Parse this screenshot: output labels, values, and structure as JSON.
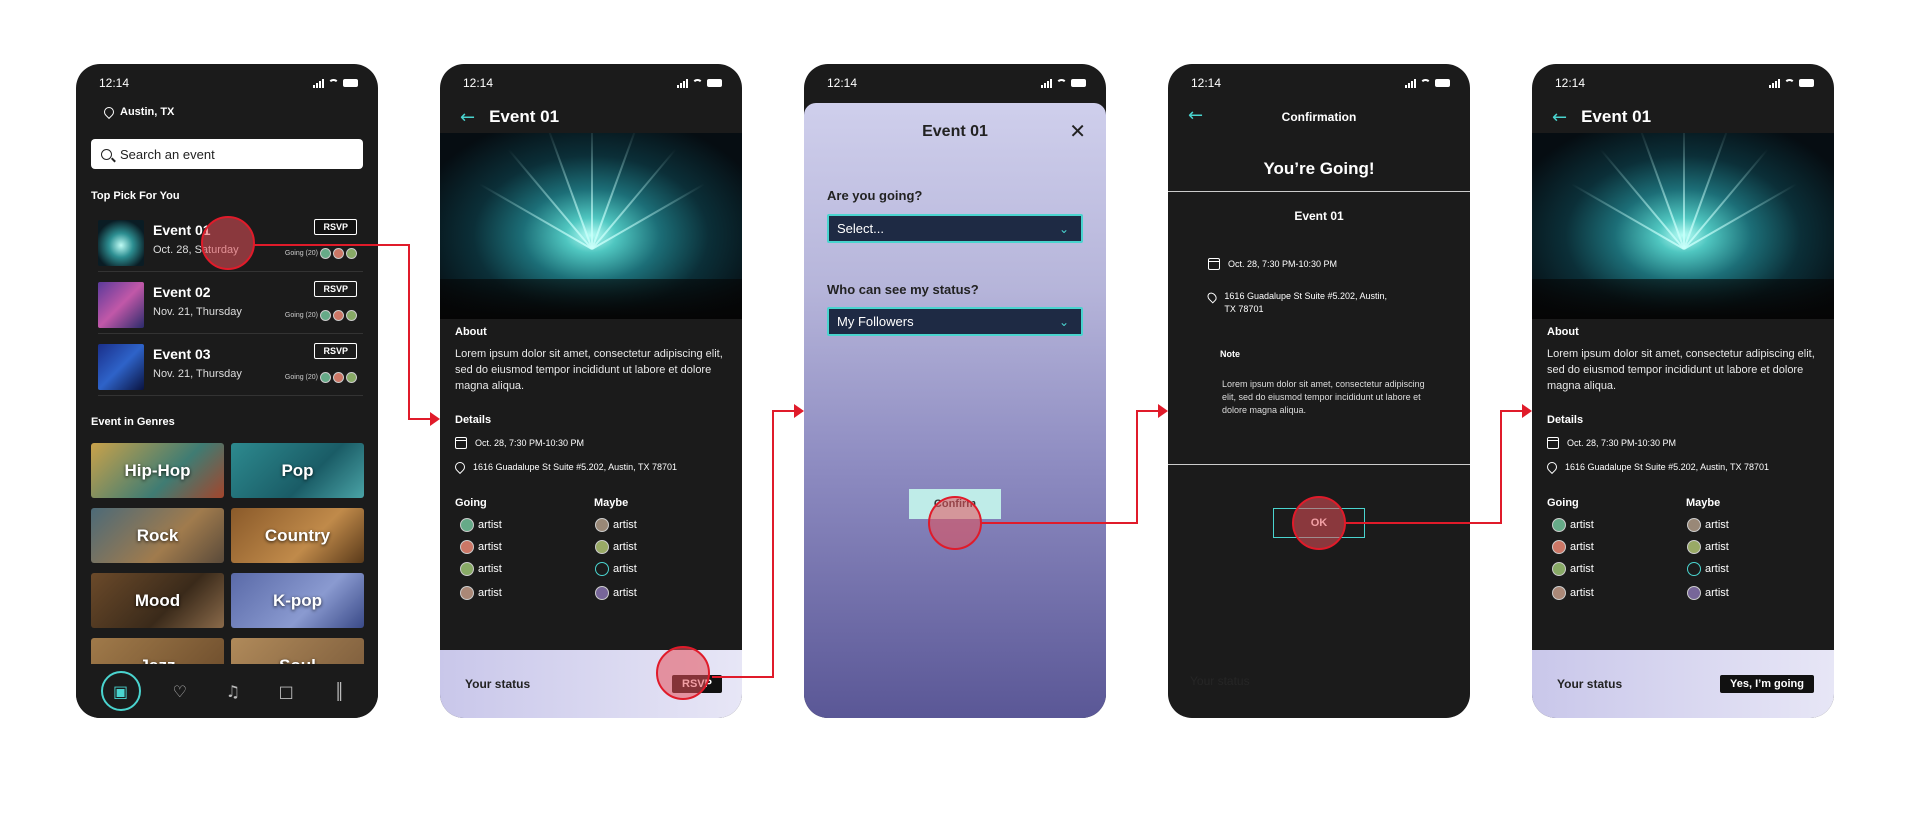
{
  "time": "12:14",
  "screen1": {
    "location": "Austin, TX",
    "search_placeholder": "Search an event",
    "top_pick_heading": "Top Pick For You",
    "events": [
      {
        "title": "Event 01",
        "date": "Oct. 28, Saturday",
        "rsvp": "RSVP",
        "going": "Going (20)"
      },
      {
        "title": "Event 02",
        "date": "Nov. 21, Thursday",
        "rsvp": "RSVP",
        "going": "Going (20)"
      },
      {
        "title": "Event 03",
        "date": "Nov. 21, Thursday",
        "rsvp": "RSVP",
        "going": "Going (20)"
      }
    ],
    "genres_heading": "Event in Genres",
    "genres": [
      "Hip-Hop",
      "Pop",
      "Rock",
      "Country",
      "Mood",
      "K-pop",
      "Jazz",
      "Soul"
    ],
    "tabs": [
      "ticket-icon",
      "heart-icon",
      "music-icon",
      "chat-icon",
      "library-icon"
    ]
  },
  "event": {
    "title": "Event 01",
    "about_heading": "About",
    "about_text": "Lorem ipsum dolor sit amet, consectetur adipiscing elit, sed do eiusmod tempor incididunt ut labore et dolore magna aliqua.",
    "details_heading": "Details",
    "date_time": "Oct. 28,  7:30 PM-10:30 PM",
    "address": "1616 Guadalupe St Suite #5.202, Austin, TX 78701",
    "going_heading": "Going",
    "maybe_heading": "Maybe",
    "going": [
      "artist",
      "artist",
      "artist",
      "artist"
    ],
    "maybe": [
      "artist",
      "artist",
      "artist",
      "artist"
    ]
  },
  "screen2": {
    "status_label": "Your status",
    "rsvp_button": "RSVP"
  },
  "screen3": {
    "title": "Event 01",
    "q1": "Are you going?",
    "q1_value": "Select...",
    "q2": "Who can see my status?",
    "q2_value": "My Followers",
    "confirm": "Confirm"
  },
  "screen4": {
    "header": "Confirmation",
    "headline": "You’re Going!",
    "event_title": "Event 01",
    "date_time": "Oct. 28,  7:30 PM-10:30 PM",
    "address": "1616 Guadalupe St Suite #5.202, Austin, TX 78701",
    "note_heading": "Note",
    "note_text": "Lorem ipsum dolor sit amet, consectetur adipiscing elit, sed do eiusmod tempor incididunt ut labore et dolore magna aliqua.",
    "ok": "OK",
    "ghost_status": "Your status"
  },
  "screen5": {
    "status_label": "Your status",
    "status_value": "Yes, I’m going"
  },
  "colors": {
    "accent": "#4ad4cf",
    "annotation": "#e01b2a",
    "phone_bg": "#1b1b1b"
  }
}
